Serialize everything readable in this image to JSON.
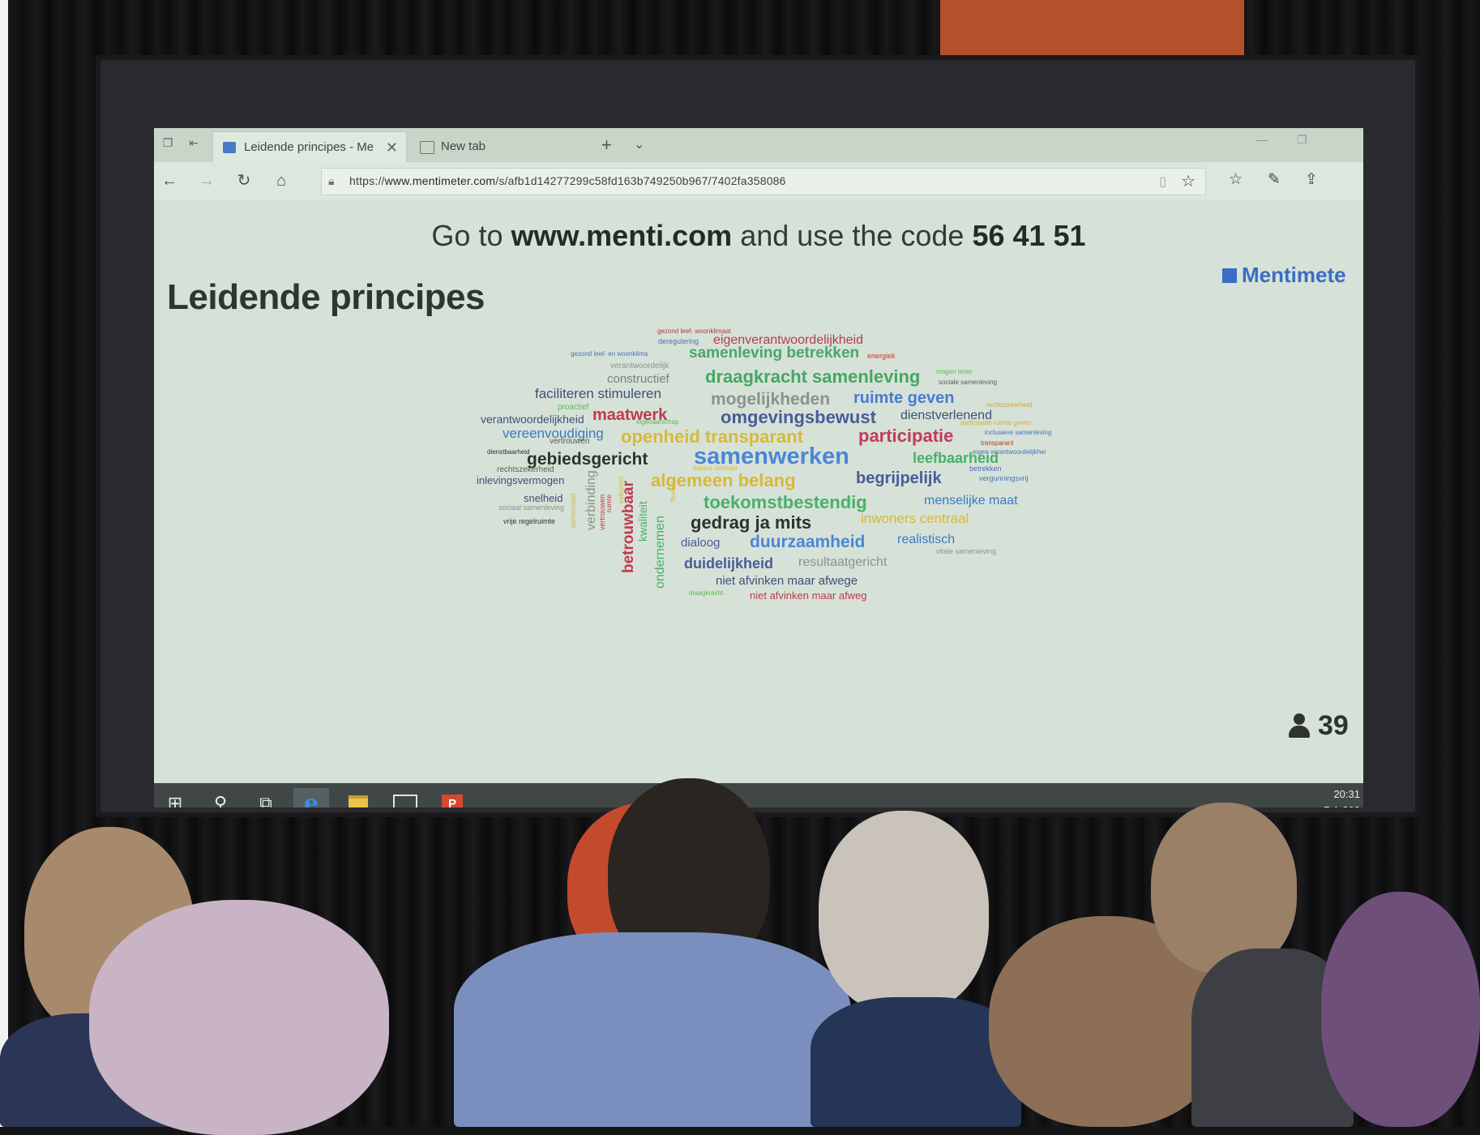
{
  "browser": {
    "tabs": [
      {
        "label": "Leidende principes - Me",
        "active": true
      },
      {
        "label": "New tab",
        "active": false
      }
    ],
    "url_prefix": "https://",
    "url_domain": "www.mentimeter.com",
    "url_path": "/s/afb1d14277299c58fd163b749250b967/7402fa358086"
  },
  "slide": {
    "join_prefix": "Go to ",
    "join_site": "www.menti.com",
    "join_middle": " and use the code ",
    "join_code": "56 41 51",
    "title": "Leidende principes",
    "brand": "Mentimete",
    "participant_count": "39"
  },
  "word_cloud": [
    {
      "text": "gezond leef- woonklimaat",
      "color": "#b2384a"
    },
    {
      "text": "deregulering",
      "color": "#4a70c0"
    },
    {
      "text": "eigenverantwoordelijkheid",
      "color": "#b23a55"
    },
    {
      "text": "gezond leef- en woonklima",
      "color": "#4a70c0"
    },
    {
      "text": "samenleving betrekken",
      "color": "#4aa66a"
    },
    {
      "text": "energiek",
      "color": "#c0392b"
    },
    {
      "text": "verantwoordelijk",
      "color": "#8c938d"
    },
    {
      "text": "constructief",
      "color": "#7a817b"
    },
    {
      "text": "draagkracht samenleving",
      "color": "#44a862"
    },
    {
      "text": "mogen leren",
      "color": "#5ab84e"
    },
    {
      "text": "sociale samenleving",
      "color": "#555d56"
    },
    {
      "text": "faciliteren stimuleren",
      "color": "#3f4f7a"
    },
    {
      "text": "mogelijkheden",
      "color": "#8b928c"
    },
    {
      "text": "ruimte geven",
      "color": "#4a7bd0"
    },
    {
      "text": "proactief",
      "color": "#5bb85a"
    },
    {
      "text": "rechtszekerheid",
      "color": "#c8a640"
    },
    {
      "text": "verantwoordelijkheid",
      "color": "#3f4f7a"
    },
    {
      "text": "maatwerk",
      "color": "#c0394f"
    },
    {
      "text": "omgevingsbewust",
      "color": "#4a5a9a"
    },
    {
      "text": "dienstverlenend",
      "color": "#3f4f7a"
    },
    {
      "text": "eigenaarschap",
      "color": "#5ab84e"
    },
    {
      "text": "participatie ruimte geven",
      "color": "#d1b040"
    },
    {
      "text": "inclusieve samenleving",
      "color": "#4a70c0"
    },
    {
      "text": "vereenvoudiging",
      "color": "#3a7ac0"
    },
    {
      "text": "openheid transparant",
      "color": "#d9b83a"
    },
    {
      "text": "participatie",
      "color": "#c23a5c"
    },
    {
      "text": "transparant",
      "color": "#c0392b"
    },
    {
      "text": "vertrouwen",
      "color": "#555d56"
    },
    {
      "text": "eigen verantwoordelijkhei",
      "color": "#4a70c0"
    },
    {
      "text": "dienstbaarheid",
      "color": "#2c332d"
    },
    {
      "text": "gebiedsgericht",
      "color": "#2c332d"
    },
    {
      "text": "samenwerken",
      "color": "#4a86d8"
    },
    {
      "text": "leefbaarheid",
      "color": "#48b06a"
    },
    {
      "text": "balans centraal",
      "color": "#d9b83a"
    },
    {
      "text": "rechtszekerheid",
      "color": "#555d56"
    },
    {
      "text": "algemeen belang",
      "color": "#d9b83a"
    },
    {
      "text": "begrijpelijk",
      "color": "#4a5a9a"
    },
    {
      "text": "betrekken",
      "color": "#4a70c0"
    },
    {
      "text": "inlevingsvermogen",
      "color": "#3f4f7a"
    },
    {
      "text": "vergunningsvrij",
      "color": "#4a70c0"
    },
    {
      "text": "toekomstbestendig",
      "color": "#48b06a"
    },
    {
      "text": "menselijke maat",
      "color": "#3a7ac0"
    },
    {
      "text": "snelheid",
      "color": "#3f4f7a"
    },
    {
      "text": "sociaal samenleving",
      "color": "#8c938d"
    },
    {
      "text": "gedrag ja mits",
      "color": "#2c332d"
    },
    {
      "text": "inwoners centraal",
      "color": "#d9b83a"
    },
    {
      "text": "vrije regelruimte",
      "color": "#2c332d"
    },
    {
      "text": "realistisch",
      "color": "#3a7ac0"
    },
    {
      "text": "dialoog",
      "color": "#4a5a9a"
    },
    {
      "text": "duurzaamheid",
      "color": "#4a86d8"
    },
    {
      "text": "vitale samenleving",
      "color": "#8c938d"
    },
    {
      "text": "duidelijkheid",
      "color": "#4a5a9a"
    },
    {
      "text": "resultaatgericht",
      "color": "#8b928c"
    },
    {
      "text": "niet afvinken maar afwege",
      "color": "#3f4f7a"
    },
    {
      "text": "draagkracht",
      "color": "#5ab84e"
    },
    {
      "text": "niet afvinken maar afweg",
      "color": "#c0394f"
    },
    {
      "text": "verbinding",
      "color": "#8b928c"
    },
    {
      "text": "betrouwbaar",
      "color": "#c0394f"
    },
    {
      "text": "kwaliteit",
      "color": "#48b06a"
    },
    {
      "text": "ondernemen",
      "color": "#48b06a"
    },
    {
      "text": "vertrouwen",
      "color": "#c0394f"
    },
    {
      "text": "samenspel",
      "color": "#d9b83a"
    },
    {
      "text": "ruimte",
      "color": "#c0394f"
    },
    {
      "text": "veiligheid",
      "color": "#d9b83a"
    },
    {
      "text": "flexibel",
      "color": "#d9b83a"
    }
  ],
  "taskbar": {
    "time": "20:31",
    "date": "7-1-202"
  }
}
